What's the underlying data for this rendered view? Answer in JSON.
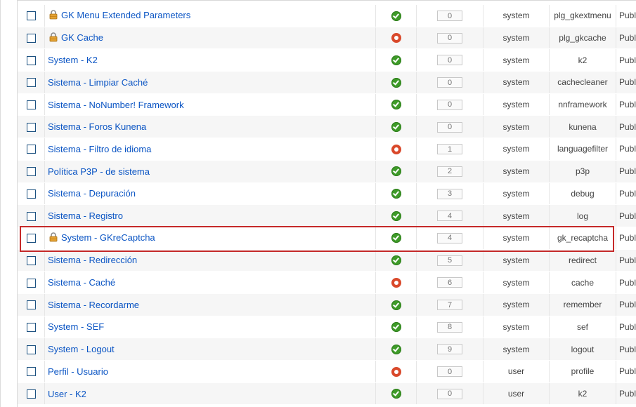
{
  "colors": {
    "link": "#0b55c4",
    "highlight": "#c52a2a",
    "enabled": "#3e9b28",
    "disabled": "#d9492b"
  },
  "rows": [
    {
      "name": "GK Menu Extended Parameters",
      "locked": true,
      "status": "enabled",
      "order": "0",
      "folder": "system",
      "element": "plg_gkextmenu",
      "access": "Public"
    },
    {
      "name": "GK Cache",
      "locked": true,
      "status": "disabled",
      "order": "0",
      "folder": "system",
      "element": "plg_gkcache",
      "access": "Public"
    },
    {
      "name": "System - K2",
      "locked": false,
      "status": "enabled",
      "order": "0",
      "folder": "system",
      "element": "k2",
      "access": "Public"
    },
    {
      "name": "Sistema - Limpiar Caché",
      "locked": false,
      "status": "enabled",
      "order": "0",
      "folder": "system",
      "element": "cachecleaner",
      "access": "Public"
    },
    {
      "name": "Sistema - NoNumber! Framework",
      "locked": false,
      "status": "enabled",
      "order": "0",
      "folder": "system",
      "element": "nnframework",
      "access": "Public"
    },
    {
      "name": "Sistema - Foros Kunena",
      "locked": false,
      "status": "enabled",
      "order": "0",
      "folder": "system",
      "element": "kunena",
      "access": "Public"
    },
    {
      "name": "Sistema - Filtro de idioma",
      "locked": false,
      "status": "disabled",
      "order": "1",
      "folder": "system",
      "element": "languagefilter",
      "access": "Public"
    },
    {
      "name": "Política P3P - de sistema",
      "locked": false,
      "status": "enabled",
      "order": "2",
      "folder": "system",
      "element": "p3p",
      "access": "Public"
    },
    {
      "name": "Sistema - Depuración",
      "locked": false,
      "status": "enabled",
      "order": "3",
      "folder": "system",
      "element": "debug",
      "access": "Public"
    },
    {
      "name": "Sistema - Registro",
      "locked": false,
      "status": "enabled",
      "order": "4",
      "folder": "system",
      "element": "log",
      "access": "Public"
    },
    {
      "name": "System - GKreCaptcha",
      "locked": true,
      "status": "enabled",
      "order": "4",
      "folder": "system",
      "element": "gk_recaptcha",
      "access": "Public"
    },
    {
      "name": "Sistema - Redirección",
      "locked": false,
      "status": "enabled",
      "order": "5",
      "folder": "system",
      "element": "redirect",
      "access": "Public"
    },
    {
      "name": "Sistema - Caché",
      "locked": false,
      "status": "disabled",
      "order": "6",
      "folder": "system",
      "element": "cache",
      "access": "Public"
    },
    {
      "name": "Sistema - Recordarme",
      "locked": false,
      "status": "enabled",
      "order": "7",
      "folder": "system",
      "element": "remember",
      "access": "Public"
    },
    {
      "name": "System - SEF",
      "locked": false,
      "status": "enabled",
      "order": "8",
      "folder": "system",
      "element": "sef",
      "access": "Public"
    },
    {
      "name": "System - Logout",
      "locked": false,
      "status": "enabled",
      "order": "9",
      "folder": "system",
      "element": "logout",
      "access": "Public"
    },
    {
      "name": "Perfil - Usuario",
      "locked": false,
      "status": "disabled",
      "order": "0",
      "folder": "user",
      "element": "profile",
      "access": "Public"
    },
    {
      "name": "User - K2",
      "locked": false,
      "status": "enabled",
      "order": "0",
      "folder": "user",
      "element": "k2",
      "access": "Public"
    }
  ],
  "highlighted_row": "System - GKreCaptcha"
}
